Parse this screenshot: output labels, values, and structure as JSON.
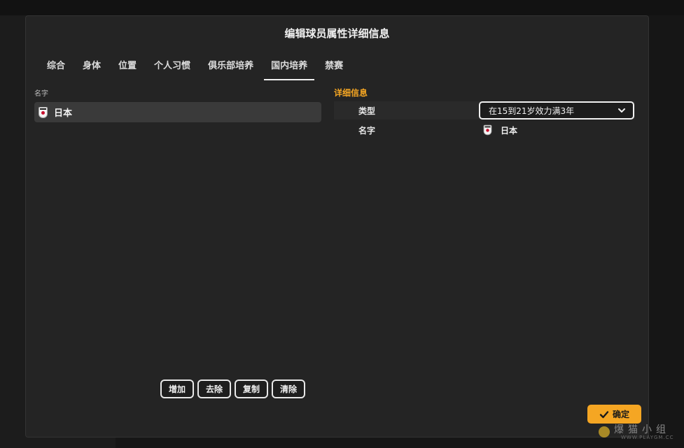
{
  "dialog": {
    "title": "编辑球员属性详细信息",
    "tabs": [
      {
        "label": "综合"
      },
      {
        "label": "身体"
      },
      {
        "label": "位置"
      },
      {
        "label": "个人习惯"
      },
      {
        "label": "俱乐部培养"
      },
      {
        "label": "国内培养",
        "active": true
      },
      {
        "label": "禁赛"
      }
    ]
  },
  "left_panel": {
    "column_label": "名字",
    "items": [
      {
        "name": "日本",
        "icon": "japan-flag-icon"
      }
    ],
    "buttons": {
      "add": "增加",
      "remove": "去除",
      "copy": "复制",
      "clear": "清除"
    }
  },
  "details": {
    "title": "详细信息",
    "type_label": "类型",
    "type_value": "在15到21岁效力满3年",
    "name_label": "名字",
    "name_value": "日本"
  },
  "footer": {
    "confirm_label": "确定"
  },
  "watermark": {
    "text": "爆猫小组",
    "url": "WWW.PLAYGM.CC"
  },
  "colors": {
    "accent": "#f5a623",
    "dialog_bg": "#242424",
    "selected_row": "#3a3a3a"
  }
}
